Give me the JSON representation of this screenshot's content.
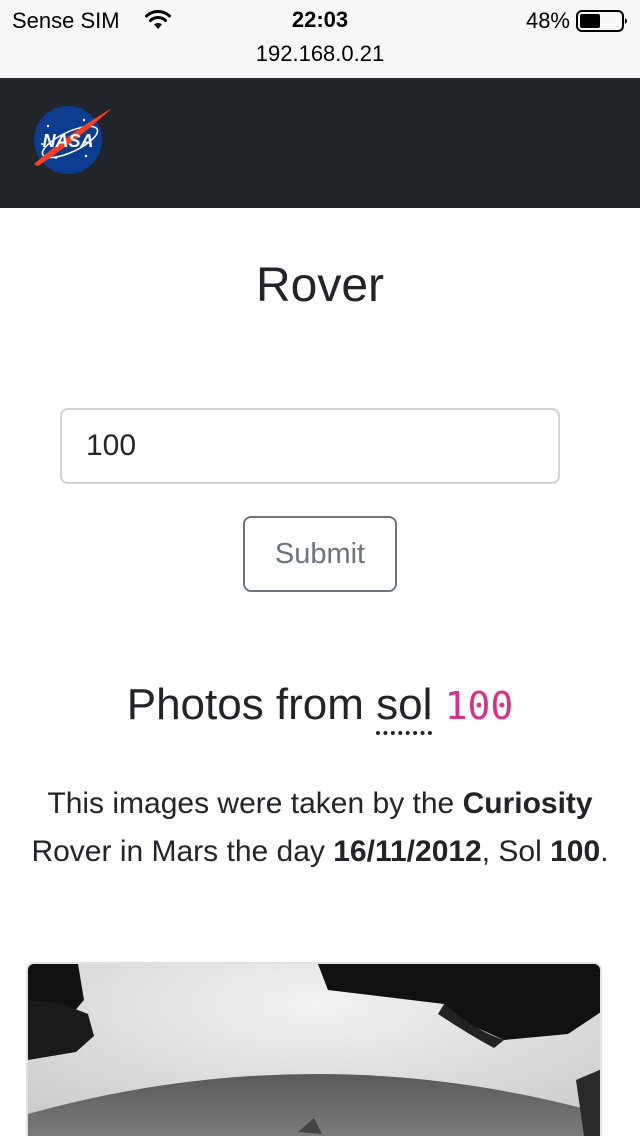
{
  "status_bar": {
    "carrier": "Sense SIM",
    "time": "22:03",
    "battery": "48%",
    "url": "192.168.0.21"
  },
  "navbar": {
    "logo_text": "NASA",
    "color": "#212529"
  },
  "page": {
    "title": "Rover"
  },
  "form": {
    "sol_value": "100",
    "submit_label": "Submit"
  },
  "photos": {
    "heading_prefix": "Photos from ",
    "heading_sol_word": "sol",
    "heading_sol_number": "100",
    "description": {
      "part1": "This images were taken by the ",
      "rover": "Curiosity",
      "part2": " Rover in Mars the day ",
      "date": "16/11/2012",
      "part3": ", Sol ",
      "sol": "100",
      "part4": "."
    },
    "image_icon": "mars-surface-photo"
  },
  "colors": {
    "accent_code": "#d63384",
    "secondary": "#6c757d",
    "text": "#212529"
  }
}
